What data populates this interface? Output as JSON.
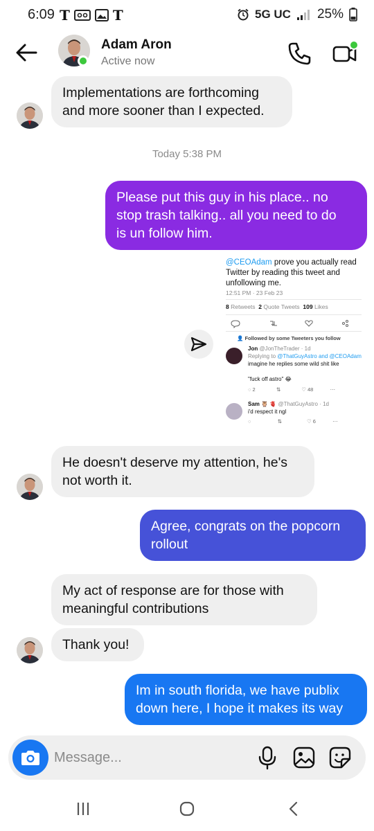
{
  "status_bar": {
    "time": "6:09",
    "network": "5G UC",
    "battery": "25%"
  },
  "header": {
    "name": "Adam Aron",
    "status": "Active now"
  },
  "messages": [
    {
      "from": "them",
      "text_lines": [
        "Implementations are forthcoming",
        "and more sooner than I expected."
      ]
    },
    {
      "timestamp": "Today 5:38 PM"
    },
    {
      "from": "me",
      "text_lines": [
        "Please put this guy in his place.. no",
        "stop trash talking.. all you need to do",
        "is un follow him."
      ]
    },
    {
      "from": "them",
      "text_lines": [
        "He doesn't deserve my attention, he's",
        "not worth it."
      ]
    },
    {
      "from": "me",
      "text_lines": [
        "Agree, congrats on the popcorn",
        "rollout"
      ]
    },
    {
      "from": "them",
      "text_lines": [
        "My act of response are for those with",
        "meaningful contributions"
      ]
    },
    {
      "from": "them",
      "text_lines": [
        "Thank you!"
      ]
    },
    {
      "from": "me",
      "text_lines": [
        "Im in south florida, we have publix",
        "down here, I hope it makes its way"
      ]
    }
  ],
  "shared_tweet": {
    "handle": "@CEOAdam",
    "text_rest_line1": " prove you actually read",
    "text_line2": "Twitter by reading this tweet and",
    "text_line3": "unfollowing me.",
    "meta": "12:51 PM · 23 Feb 23",
    "retweets_count": "8",
    "retweets_label": " Retweets",
    "quotes_count": "2",
    "quotes_label": " Quote Tweets",
    "likes_count": "109",
    "likes_label": " Likes",
    "followed_by": "Followed by some Tweeters you follow",
    "reply1": {
      "name": "Jon",
      "handle_time": "@JonTheTrader · 1d",
      "replying_prefix": "Replying to ",
      "replying_to": "@ThatGuyAstro and @CEOAdam",
      "body_line1": "imagine he replies some wild shit like",
      "body_line2": "\"fuck off astro\" 😂",
      "replies": "2",
      "likes": "48"
    },
    "reply2": {
      "name": "Sam 🦉 🫀",
      "handle_time": "@ThatGuyAstro · 1d",
      "body": "i'd respect it ngl",
      "likes": "6"
    }
  },
  "composer": {
    "placeholder": "Message..."
  },
  "colors": {
    "incoming_bubble": "#efefef",
    "outgoing_purple": "#8a2be2",
    "outgoing_indigo": "#4652d8",
    "outgoing_blue": "#1877f2",
    "online": "#3cc83c",
    "link": "#1d9bf0"
  },
  "icons": {
    "back": "arrow-left",
    "call": "phone",
    "video": "video-camera",
    "camera": "camera",
    "mic": "microphone",
    "gallery": "image",
    "sticker": "sticker",
    "share": "paper-plane"
  }
}
